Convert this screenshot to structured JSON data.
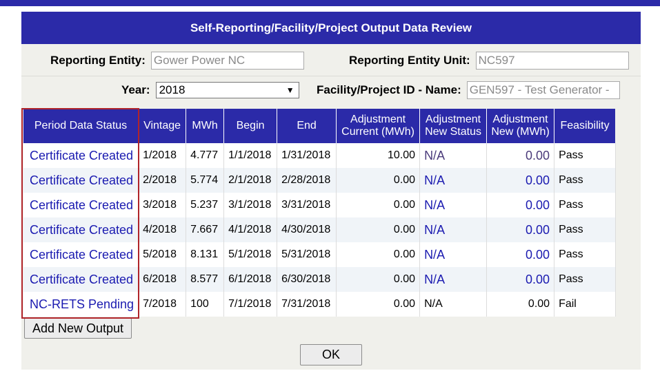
{
  "dialog": {
    "title": "Self-Reporting/Facility/Project Output Data Review"
  },
  "form": {
    "reporting_entity_label": "Reporting Entity:",
    "reporting_entity_value": "Gower Power NC",
    "reporting_entity_unit_label": "Reporting Entity Unit:",
    "reporting_entity_unit_value": "NC597",
    "year_label": "Year:",
    "year_value": "2018",
    "facility_label": "Facility/Project ID - Name:",
    "facility_value": "GEN597 - Test Generator -"
  },
  "table": {
    "headers": [
      "Period Data Status",
      "Vintage",
      "MWh",
      "Begin",
      "End",
      "Adjustment Current (MWh)",
      "Adjustment New Status",
      "Adjustment New (MWh)",
      "Feasibility"
    ],
    "rows": [
      {
        "status": "Certificate Created",
        "vintage": "1/2018",
        "mwh": "4.777",
        "begin": "1/1/2018",
        "end": "1/31/2018",
        "adj_current": "10.00",
        "adj_status": "N/A",
        "adj_new": "0.00",
        "feasibility": "Pass"
      },
      {
        "status": "Certificate Created",
        "vintage": "2/2018",
        "mwh": "5.774",
        "begin": "2/1/2018",
        "end": "2/28/2018",
        "adj_current": "0.00",
        "adj_status": "N/A",
        "adj_new": "0.00",
        "feasibility": "Pass"
      },
      {
        "status": "Certificate Created",
        "vintage": "3/2018",
        "mwh": "5.237",
        "begin": "3/1/2018",
        "end": "3/31/2018",
        "adj_current": "0.00",
        "adj_status": "N/A",
        "adj_new": "0.00",
        "feasibility": "Pass"
      },
      {
        "status": "Certificate Created",
        "vintage": "4/2018",
        "mwh": "7.667",
        "begin": "4/1/2018",
        "end": "4/30/2018",
        "adj_current": "0.00",
        "adj_status": "N/A",
        "adj_new": "0.00",
        "feasibility": "Pass"
      },
      {
        "status": "Certificate Created",
        "vintage": "5/2018",
        "mwh": "8.131",
        "begin": "5/1/2018",
        "end": "5/31/2018",
        "adj_current": "0.00",
        "adj_status": "N/A",
        "adj_new": "0.00",
        "feasibility": "Pass"
      },
      {
        "status": "Certificate Created",
        "vintage": "6/2018",
        "mwh": "8.577",
        "begin": "6/1/2018",
        "end": "6/30/2018",
        "adj_current": "0.00",
        "adj_status": "N/A",
        "adj_new": "0.00",
        "feasibility": "Pass"
      },
      {
        "status": "NC-RETS Pending",
        "vintage": "7/2018",
        "mwh": "100",
        "begin": "7/1/2018",
        "end": "7/31/2018",
        "adj_current": "0.00",
        "adj_status": "N/A",
        "adj_new": "0.00",
        "feasibility": "Fail"
      }
    ]
  },
  "buttons": {
    "add_new_output": "Add New Output",
    "ok": "OK"
  },
  "colors": {
    "header_bg": "#2b2aa8",
    "link": "#1a1ab0",
    "highlight_box": "#b0242a",
    "dialog_bg": "#f0f0eb"
  }
}
